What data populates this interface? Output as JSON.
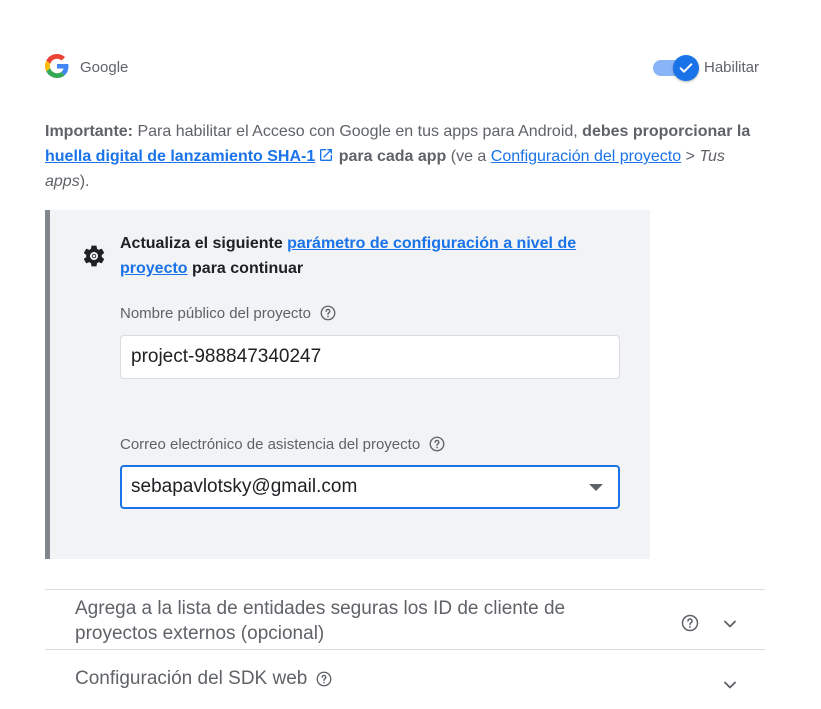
{
  "header": {
    "provider_name": "Google",
    "toggle_label": "Habilitar",
    "toggle_state": "on"
  },
  "notice": {
    "bold_prefix": "Importante:",
    "text_1": " Para habilitar el Acceso con Google en tus apps para Android, ",
    "bold_1": "debes proporcionar la ",
    "link_sha": "huella digital de lanzamiento SHA-1",
    "bold_2": " para cada app",
    "text_2": " (ve a ",
    "link_config": "Configuración del proyecto",
    "text_3": " > ",
    "italic": "Tus apps",
    "text_4": ")."
  },
  "panel": {
    "msg_prefix": "Actualiza el siguiente ",
    "msg_link": "parámetro de configuración a nivel de proyecto",
    "msg_suffix": " para continuar",
    "name_label": "Nombre público del proyecto",
    "name_value": "project-988847340247",
    "email_label": "Correo electrónico de asistencia del proyecto",
    "email_value": "sebapavlotsky@gmail.com"
  },
  "expanders": {
    "external_clients": "Agrega a la lista de entidades seguras los ID de cliente de proyectos externos (opcional)",
    "web_sdk": "Configuración del SDK web"
  },
  "colors": {
    "accent": "#1a73e8",
    "panel_bg": "#f1f3f4",
    "panel_border": "#80868b"
  }
}
